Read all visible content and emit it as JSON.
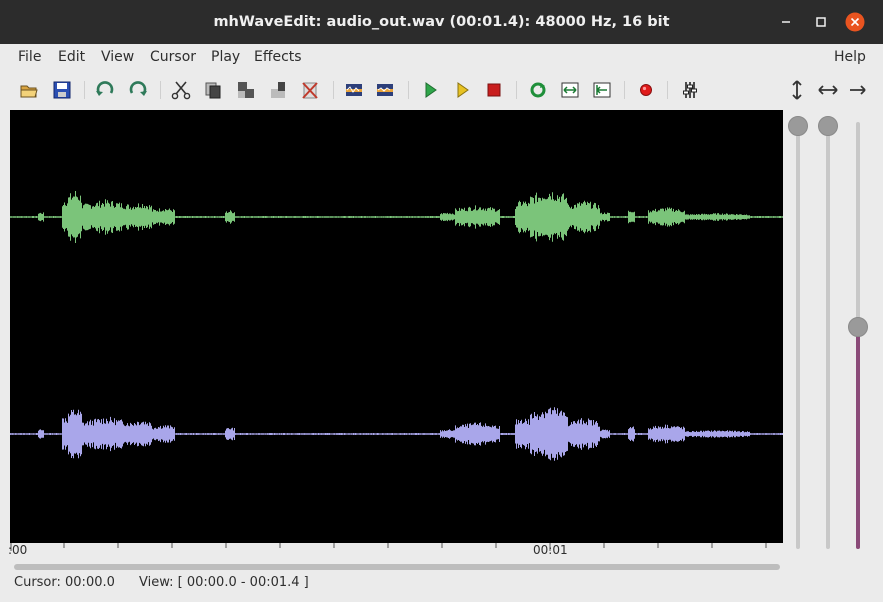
{
  "window": {
    "title": "mhWaveEdit: audio_out.wav (00:01.4): 48000 Hz, 16 bit"
  },
  "menu": {
    "file": "File",
    "edit": "Edit",
    "view": "View",
    "cursor": "Cursor",
    "play": "Play",
    "effects": "Effects",
    "help": "Help"
  },
  "ruler": {
    "start": ":00",
    "mark1": "00:01"
  },
  "status": {
    "cursor": "Cursor: 00:00.0",
    "view": "View: [ 00:00.0 - 00:01.4 ]"
  },
  "colors": {
    "channel1": "#7bc47a",
    "channel2": "#a9a6ea",
    "slider_fill": "#8a4a78",
    "titlebar": "#2c2c2c",
    "close": "#e95420"
  },
  "sliders": {
    "volume": 1.0,
    "speed": 1.0,
    "position": 0.52
  }
}
